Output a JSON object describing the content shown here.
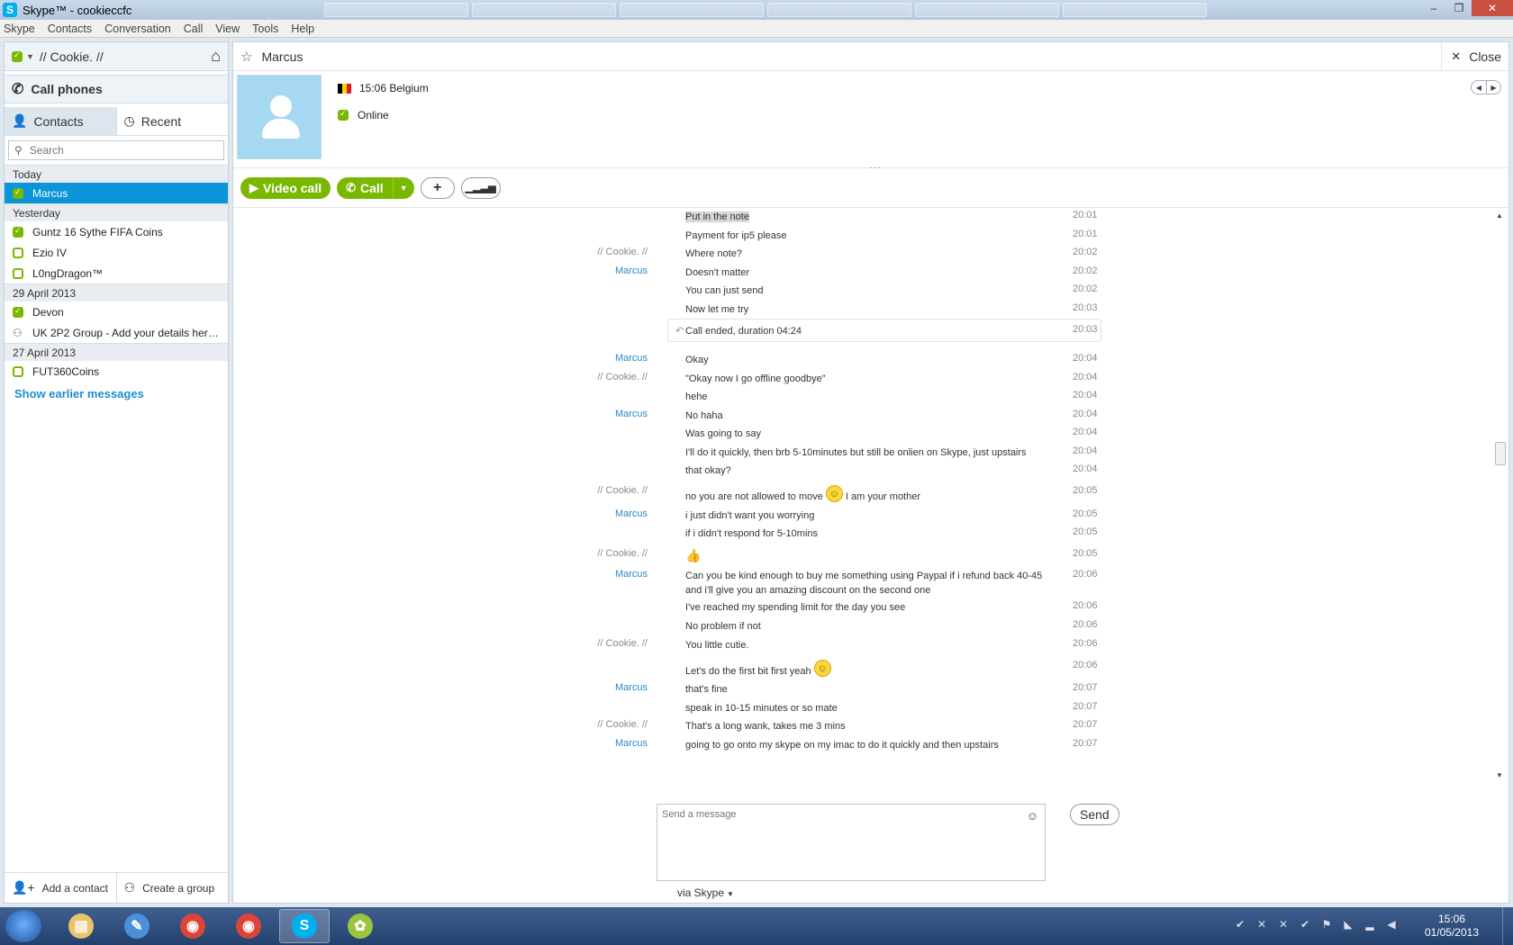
{
  "window": {
    "title": "Skype™ - cookieccfc",
    "app_icon": "S",
    "controls": [
      "–",
      "❐",
      "✕"
    ]
  },
  "menu": [
    "Skype",
    "Contacts",
    "Conversation",
    "Call",
    "View",
    "Tools",
    "Help"
  ],
  "sidebar": {
    "profile_name": "// Cookie. //",
    "call_phones": "Call phones",
    "tab_contacts": "Contacts",
    "tab_recent": "Recent",
    "search_placeholder": "Search",
    "groups": [
      {
        "label": "Today",
        "items": [
          {
            "name": "Marcus",
            "status": "online",
            "selected": true
          }
        ]
      },
      {
        "label": "Yesterday",
        "items": [
          {
            "name": "Guntz 16 Sythe FIFA Coins",
            "status": "online"
          },
          {
            "name": "Ezio IV",
            "status": "offline"
          },
          {
            "name": "L0ngDragon™",
            "status": "offline"
          }
        ]
      },
      {
        "label": "29 April 2013",
        "items": [
          {
            "name": "Devon",
            "status": "online"
          },
          {
            "name": "UK 2P2 Group - Add your details here - ht...",
            "status": "group"
          }
        ]
      },
      {
        "label": "27 April 2013",
        "items": [
          {
            "name": "FUT360Coins",
            "status": "offline"
          }
        ]
      }
    ],
    "show_earlier": "Show earlier messages",
    "add_contact": "Add a contact",
    "create_group": "Create a group"
  },
  "conversation": {
    "name": "Marcus",
    "close_label": "Close",
    "local_time": "15:06 Belgium",
    "status": "Online",
    "flag_colors": [
      "#000000",
      "#f5d90a",
      "#e31b23"
    ],
    "video_call": "Video call",
    "call": "Call",
    "messages": [
      {
        "sender": "",
        "who": "other",
        "text": "Put in the note",
        "time": "20:01",
        "highlight": true
      },
      {
        "sender": "",
        "who": "other",
        "text": "Payment for ip5 please",
        "time": "20:01"
      },
      {
        "sender": "// Cookie. //",
        "who": "me",
        "text": "Where note?",
        "time": "20:02"
      },
      {
        "sender": "Marcus",
        "who": "other",
        "text": "Doesn't matter",
        "time": "20:02"
      },
      {
        "sender": "",
        "who": "other",
        "text": "You can just send",
        "time": "20:02"
      },
      {
        "sender": "",
        "who": "other",
        "text": "Now let me try",
        "time": "20:03"
      },
      {
        "type": "call",
        "text": "Call ended, duration 04:24",
        "time": "20:03"
      },
      {
        "sender": "Marcus",
        "who": "other",
        "text": "Okay",
        "time": "20:04"
      },
      {
        "sender": "// Cookie. //",
        "who": "me",
        "text": "\"Okay now I go offline goodbye\"",
        "time": "20:04"
      },
      {
        "sender": "",
        "who": "me",
        "text": "hehe",
        "time": "20:04"
      },
      {
        "sender": "Marcus",
        "who": "other",
        "text": "No haha",
        "time": "20:04"
      },
      {
        "sender": "",
        "who": "other",
        "text": "Was going to say",
        "time": "20:04"
      },
      {
        "sender": "",
        "who": "other",
        "text": "I'll do it quickly, then brb 5-10minutes but still be onlien on Skype, just upstairs",
        "time": "20:04"
      },
      {
        "sender": "",
        "who": "other",
        "text": "that okay?",
        "time": "20:04"
      },
      {
        "sender": "// Cookie. //",
        "who": "me",
        "text": "no you are not allowed to move",
        "text2": "I am your mother",
        "emoticon": "smile",
        "time": "20:05"
      },
      {
        "sender": "Marcus",
        "who": "other",
        "text": "i just didn't want you worrying",
        "time": "20:05"
      },
      {
        "sender": "",
        "who": "other",
        "text": "if i didn't respond for 5-10mins",
        "time": "20:05"
      },
      {
        "sender": "// Cookie. //",
        "who": "me",
        "text": "",
        "emoticon": "thumbs-up",
        "time": "20:05"
      },
      {
        "sender": "Marcus",
        "who": "other",
        "text": "Can you be kind enough to buy me something using Paypal if i refund back 40-45 and i'll give you an amazing discount on the second one",
        "time": "20:06"
      },
      {
        "sender": "",
        "who": "other",
        "text": "I've reached my spending limit for the day you see",
        "time": "20:06"
      },
      {
        "sender": "",
        "who": "other",
        "text": "No problem if not",
        "time": "20:06"
      },
      {
        "sender": "// Cookie. //",
        "who": "me",
        "text": "You little cutie.",
        "time": "20:06"
      },
      {
        "sender": "",
        "who": "me",
        "text": "Let's do the first bit first yeah",
        "emoticon": "smile",
        "time": "20:06"
      },
      {
        "sender": "Marcus",
        "who": "other",
        "text": "that's fine",
        "time": "20:07"
      },
      {
        "sender": "",
        "who": "other",
        "text": "speak in 10-15 minutes or so mate",
        "time": "20:07"
      },
      {
        "sender": "// Cookie. //",
        "who": "me",
        "text": "That's a long wank, takes me 3 mins",
        "time": "20:07"
      },
      {
        "sender": "Marcus",
        "who": "other",
        "text": "going to go onto my skype on my imac to do it quickly and then upstairs",
        "time": "20:07"
      }
    ],
    "compose_placeholder": "Send a message",
    "send_label": "Send",
    "via_label": "via Skype"
  },
  "taskbar": {
    "time": "15:06",
    "date": "01/05/2013",
    "apps": [
      {
        "name": "file-explorer",
        "color": "#e9c46a"
      },
      {
        "name": "notepad",
        "color": "#4a90d9"
      },
      {
        "name": "chrome-1",
        "color": "#db4437"
      },
      {
        "name": "chrome-2",
        "color": "#db4437"
      },
      {
        "name": "skype",
        "color": "#00aff0"
      },
      {
        "name": "paint",
        "color": "#9bc53d"
      }
    ]
  },
  "colors": {
    "accent_blue": "#0b94d8",
    "online_green": "#7ab800",
    "link_blue": "#1a8fd0"
  }
}
